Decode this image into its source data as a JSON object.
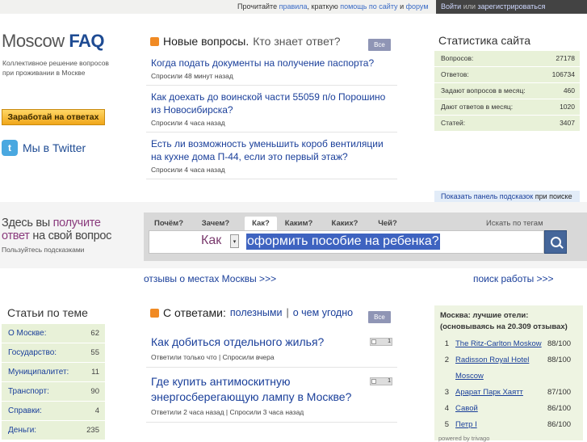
{
  "topbar": {
    "notice_prefix": "Прочитайте",
    "rules_link": "правила",
    "short_text": ", краткую",
    "help_link": "помощь по сайту",
    "and_text": "и",
    "forum_link": "форум",
    "login_link": "Войти",
    "or_text": "или",
    "register_link": "зарегистрироваться"
  },
  "logo": {
    "part1": "Moscow",
    "part2": "FAQ",
    "tagline": "Коллективное решение вопросов при проживании в Москве"
  },
  "earn_button": "Заработай на ответах",
  "twitter": {
    "icon": "twitter-icon",
    "glyph": "t",
    "label": "Мы в Twitter"
  },
  "new_questions": {
    "title": "Новые вопросы.",
    "subtitle": "Кто знает ответ?",
    "all_label": "Все",
    "items": [
      {
        "title": "Когда подать документы на получение паспорта?",
        "meta": "Спросили 48 минут назад"
      },
      {
        "title": "Как доехать до воинской части 55059 п/о Порошино из Новосибирска?",
        "meta": "Спросили 4 часа назад"
      },
      {
        "title": "Есть ли возможность уменьшить короб вентиляции на кухне дома П-44, если это первый этаж?",
        "meta": "Спросили 4 часа назад"
      }
    ]
  },
  "stats": {
    "title": "Статистика сайта",
    "rows": [
      {
        "label": "Вопросов:",
        "value": "27178"
      },
      {
        "label": "Ответов:",
        "value": "106734"
      },
      {
        "label": "Задают вопросов в месяц:",
        "value": "460"
      },
      {
        "label": "Дают ответов в месяц:",
        "value": "1020"
      },
      {
        "label": "Статей:",
        "value": "3407"
      }
    ],
    "hint_link": "Показать панель подсказок",
    "hint_suffix": "при поиске"
  },
  "search": {
    "title_l1_a": "Здесь вы",
    "title_l1_b": "получите",
    "title_l2_a": "ответ",
    "title_l2_b": "на свой вопрос",
    "subtitle": "Пользуйтесь подсказками",
    "tabs": [
      "Почём?",
      "Зачем?",
      "Как?",
      "Каким?",
      "Каких?",
      "Чей?"
    ],
    "active_tab": "Как?",
    "tag_search": "Искать по тегам",
    "question_word": "Как",
    "query": "оформить пособие на ребенка?",
    "select_glyph": "▾"
  },
  "promo": {
    "left": "отзывы о местах Москвы >>>",
    "right": "поиск работы >>>"
  },
  "articles": {
    "title": "Статьи по теме",
    "rows": [
      {
        "label": "О Москве:",
        "count": "62"
      },
      {
        "label": "Государство:",
        "count": "55"
      },
      {
        "label": "Муниципалитет:",
        "count": "11"
      },
      {
        "label": "Транспорт:",
        "count": "90"
      },
      {
        "label": "Справки:",
        "count": "4"
      },
      {
        "label": "Деньги:",
        "count": "235"
      }
    ]
  },
  "answered": {
    "title": "С ответами:",
    "filter_useful": "полезными",
    "separator": "|",
    "filter_about": "о чем угодно",
    "all_label": "Все",
    "items": [
      {
        "title": "Как добиться отдельного жилья?",
        "meta": "Ответили только что  | Спросили вчера",
        "votes": "1"
      },
      {
        "title": "Где купить антимоскитную энергосберегающую лампу в Москве?",
        "meta": "Ответили 2 часа назад  | Спросили 3 часа назад",
        "votes": "1"
      }
    ]
  },
  "hotels": {
    "title": "Москва: лучшие отели: (основываясь на 20.309 отзывах)",
    "items": [
      {
        "rank": "1",
        "name": "The Ritz-Carlton Moskow",
        "score": "88/100"
      },
      {
        "rank": "2",
        "name": "Radisson Royal Hotel Moscow",
        "score": "88/100"
      },
      {
        "rank": "3",
        "name": "Арарат Парк Хаятт",
        "score": "87/100"
      },
      {
        "rank": "4",
        "name": "Савой",
        "score": "86/100"
      },
      {
        "rank": "5",
        "name": "Петр I",
        "score": "86/100"
      }
    ],
    "powered": "powered by trivago"
  }
}
